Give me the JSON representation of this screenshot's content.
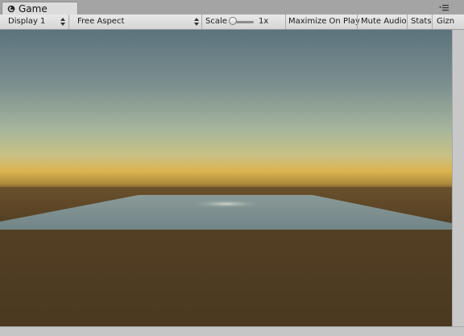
{
  "tab": {
    "title": "Game"
  },
  "toolbar": {
    "display_label": "Display 1",
    "aspect_label": "Free Aspect",
    "scale_label": "Scale",
    "scale_value": "1x",
    "scale_slider_fraction": 0.0,
    "maximize_label": "Maximize On Play",
    "mute_label": "Mute Audio",
    "stats_label": "Stats",
    "gizmos_label": "Gizn"
  },
  "icons": {
    "tab": "unity-game-icon",
    "menu": "tab-menu-icon",
    "dropdown": "updown-arrows-icon"
  },
  "scene_colors": {
    "sky_top": "#5f7680",
    "sky_mid": "#a9b69f",
    "horizon_glow": "#d9b14e",
    "ground": "#4b3820",
    "plane": "#7a8c8f"
  }
}
